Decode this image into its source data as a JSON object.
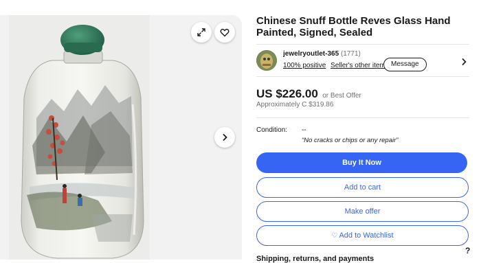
{
  "listing": {
    "title": "Chinese Snuff Bottle Reves Glass Hand Painted, Signed, Sealed"
  },
  "seller": {
    "name": "jewelryoutlet-365",
    "feedback_count": "(1771)",
    "positive": "100% positive",
    "other_items": "Seller's other items",
    "message_label": "Message"
  },
  "price": {
    "amount": "US $226.00",
    "or_best_offer": "or Best Offer",
    "approx": "Approximately C $319.86"
  },
  "condition": {
    "label": "Condition:",
    "value": "--",
    "description": "“No cracks or chips or any repair”"
  },
  "actions": {
    "buy_now": "Buy It Now",
    "add_to_cart": "Add to cart",
    "make_offer": "Make offer",
    "add_to_watchlist": "Add to Watchlist"
  },
  "section_heading": "Shipping, returns, and payments",
  "help_label": "?",
  "icons": [
    "expand-icon",
    "heart-icon",
    "chevron-right-icon",
    "help-icon"
  ],
  "colors": {
    "accent": "#3665f3",
    "text": "#191919",
    "muted": "#707070"
  }
}
